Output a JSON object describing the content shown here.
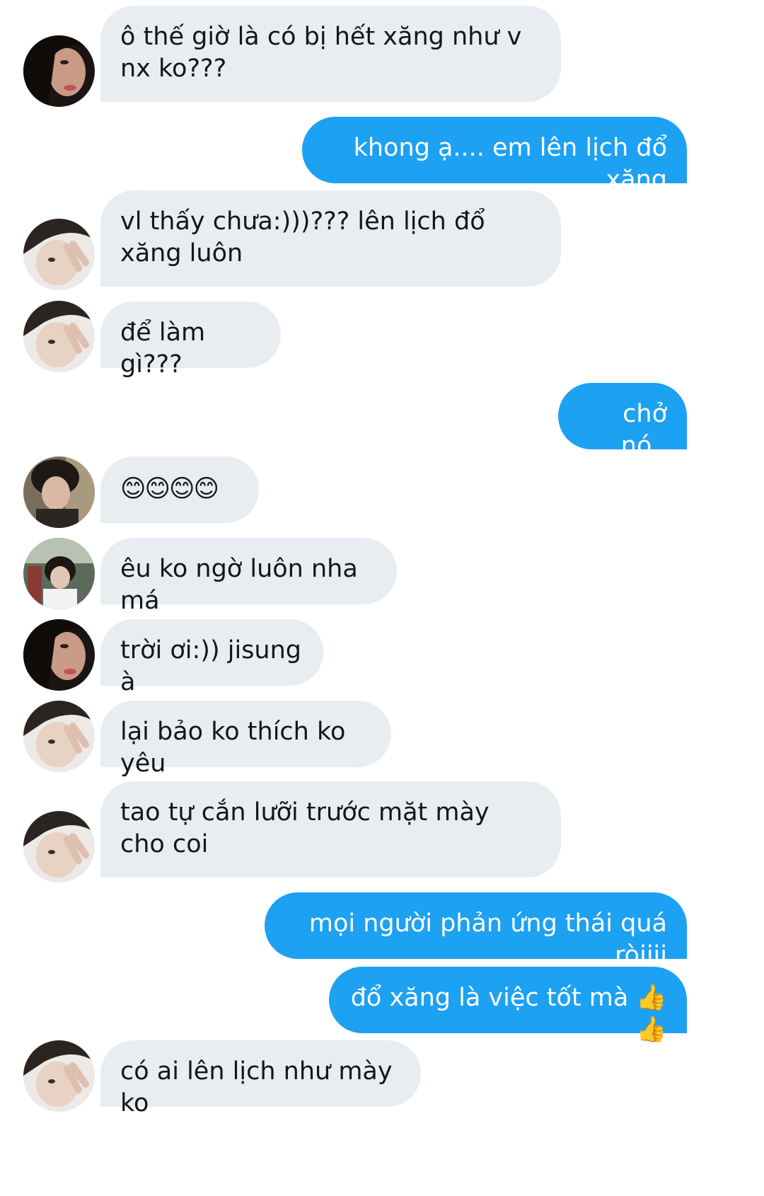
{
  "conversation": {
    "messages": [
      {
        "side": "in",
        "avatar": "avatar-hooded-dark",
        "text": "ô thế giờ là có bị hết xăng như v nx ko???"
      },
      {
        "side": "out",
        "text": "khong ạ.... em lên lịch đổ xăng"
      },
      {
        "side": "in",
        "avatar": "avatar-peace-sign",
        "text": "vl thấy chưa:)))??? lên lịch đổ xăng luôn"
      },
      {
        "side": "in",
        "avatar": "avatar-peace-sign",
        "text": "để làm gì???"
      },
      {
        "side": "out",
        "text": "chở nó.."
      },
      {
        "side": "in",
        "avatar": "avatar-curly-hair",
        "text": "😊😊😊😊"
      },
      {
        "side": "in",
        "avatar": "avatar-bus-seat",
        "text": "êu ko ngờ luôn nha má"
      },
      {
        "side": "in",
        "avatar": "avatar-hooded-dark",
        "text": "trời ơi:)) jisung à"
      },
      {
        "side": "in",
        "avatar": "avatar-peace-sign",
        "text": "lại bảo ko thích ko yêu"
      },
      {
        "side": "in",
        "avatar": "avatar-peace-sign",
        "text": "tao tự cắn lưỡi trước mặt mày cho coi"
      },
      {
        "side": "out",
        "text": "mọi người phản ứng thái quá ròiiii"
      },
      {
        "side": "out",
        "text": "đổ xăng là việc tốt mà 👍👍"
      },
      {
        "side": "in",
        "avatar": "avatar-peace-sign",
        "text": "có ai lên lịch như mày ko"
      }
    ]
  },
  "colors": {
    "incoming_bubble": "#e9edf1",
    "outgoing_bubble": "#1da1f2",
    "incoming_text": "#14171a",
    "outgoing_text": "#ffffff"
  }
}
